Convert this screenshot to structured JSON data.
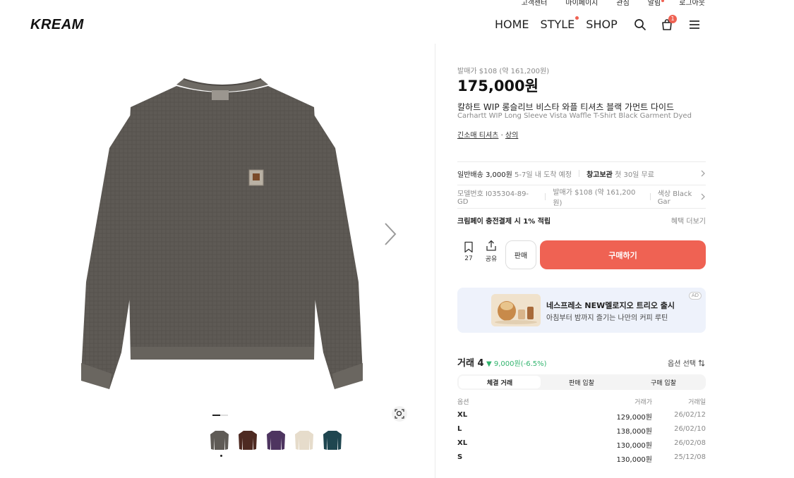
{
  "util_links": [
    "고객센터",
    "마이페이지",
    "관심",
    "알림",
    "로그아웃"
  ],
  "brand": "KREAM",
  "nav": {
    "home": "HOME",
    "style": "STYLE",
    "shop": "SHOP"
  },
  "cart_count": "1",
  "product": {
    "release_price": "발매가 $108 (약 161,200원)",
    "price": "175,000원",
    "name_ko": "칼하트 WIP 롱슬리브 비스타 와플 티셔츠 블랙 가먼트 다이드",
    "name_en": "Carhartt WIP Long Sleeve Vista Waffle T-Shirt Black Garment Dyed",
    "category_1": "긴소매 티셔츠",
    "category_sep": " · ",
    "category_2": "상의"
  },
  "shipping": {
    "label": "일반배송 3,000원",
    "eta": "5-7일 내 도착 예정",
    "storage_label": "창고보관",
    "storage_note": "첫 30일 무료"
  },
  "specs": {
    "model": "모델번호 I035304-89-GD",
    "release": "발매가 $108 (약 161,200원)",
    "color": "색상 Black Gar"
  },
  "benefit": {
    "text": "크림페이 충전결제 시 1% 적립",
    "more": "혜택 더보기"
  },
  "actions": {
    "wish_count": "27",
    "share_label": "공유",
    "sell_label": "판매",
    "buy_label": "구매하기"
  },
  "ad": {
    "title": "네스프레소 NEW멜로지오 트리오 출시",
    "subtitle": "아침부터 밤까지 즐기는 나만의 커피 루틴",
    "tag": "AD"
  },
  "trades": {
    "title": "거래 4",
    "change": "▼ 9,000원(-6.5%)",
    "option_select": "옵션 선택",
    "tabs": [
      "체결 거래",
      "판매 입찰",
      "구매 입찰"
    ],
    "headers": [
      "옵션",
      "거래가",
      "거래일"
    ],
    "rows": [
      [
        "XL",
        "129,000원",
        "26/02/12"
      ],
      [
        "L",
        "138,000원",
        "26/02/10"
      ],
      [
        "XL",
        "130,000원",
        "26/02/08"
      ],
      [
        "S",
        "130,000원",
        "25/12/08"
      ]
    ]
  },
  "colors": {
    "accent": "#ef6253",
    "down": "#31b46e"
  },
  "thumbnails": [
    "gray",
    "brown",
    "purple",
    "cream",
    "teal"
  ]
}
